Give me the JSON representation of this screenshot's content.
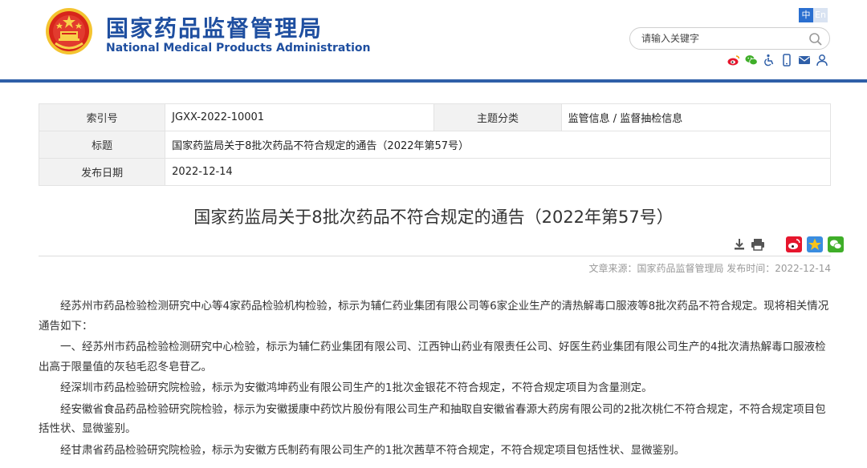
{
  "header": {
    "title_cn": "国家药品监督管理局",
    "title_en": "National Medical Products Administration",
    "lang_zh": "中",
    "lang_en": "En",
    "search_placeholder": "请输入关键字",
    "icons": [
      "weibo-icon",
      "wechat-icon",
      "accessibility-icon",
      "mobile-icon",
      "mail-icon",
      "user-icon"
    ]
  },
  "meta": {
    "index_label": "索引号",
    "index_value": "JGXX-2022-10001",
    "category_label": "主题分类",
    "category_value": "监管信息 / 监督抽检信息",
    "title_label": "标题",
    "title_value": "国家药监局关于8批次药品不符合规定的通告（2022年第57号）",
    "date_label": "发布日期",
    "date_value": "2022-12-14"
  },
  "article": {
    "title": "国家药监局关于8批次药品不符合规定的通告（2022年第57号）",
    "source": "文章来源：国家药品监督管理局 发布时间：2022-12-14",
    "paragraphs": [
      "经苏州市药品检验检测研究中心等4家药品检验机构检验，标示为辅仁药业集团有限公司等6家企业生产的清热解毒口服液等8批次药品不符合规定。现将相关情况通告如下：",
      "一、经苏州市药品检验检测研究中心检验，标示为辅仁药业集团有限公司、江西钟山药业有限责任公司、好医生药业集团有限公司生产的4批次清热解毒口服液检出高于限量值的灰毡毛忍冬皂苷乙。",
      "经深圳市药品检验研究院检验，标示为安徽鸿坤药业有限公司生产的1批次金银花不符合规定，不符合规定项目为含量测定。",
      "经安徽省食品药品检验研究院检验，标示为安徽援康中药饮片股份有限公司生产和抽取自安徽省春源大药房有限公司的2批次桃仁不符合规定，不符合规定项目包括性状、显微鉴别。",
      "经甘肃省药品检验研究院检验，标示为安徽方氏制药有限公司生产的1批次茜草不符合规定，不符合规定项目包括性状、显微鉴别。"
    ]
  },
  "colors": {
    "brand_blue": "#1f4fa0",
    "rule_blue": "#2f5fa8",
    "emblem_red": "#d7261b",
    "emblem_gold": "#f4c430"
  }
}
